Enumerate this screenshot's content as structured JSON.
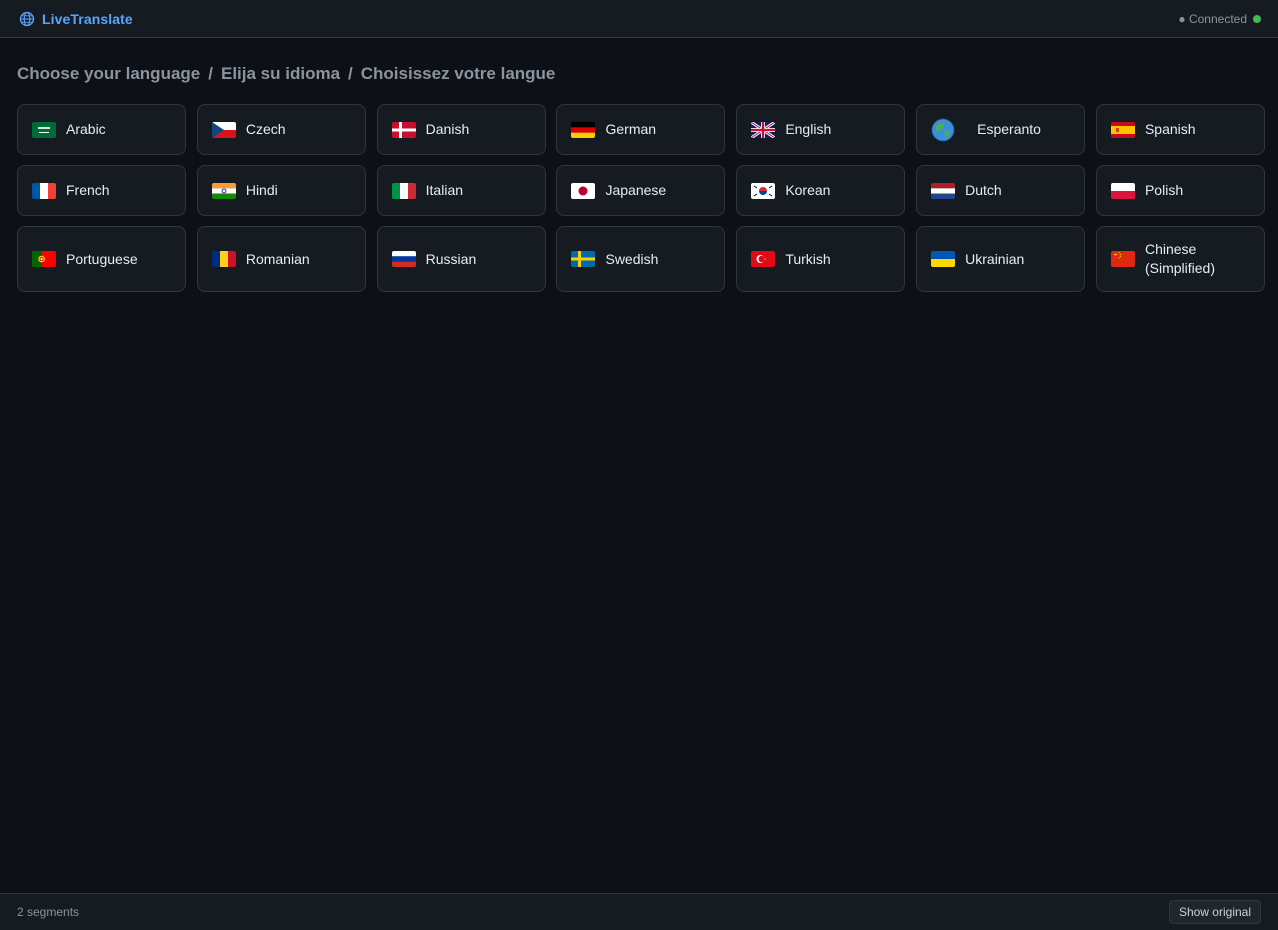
{
  "header": {
    "brand_icon": "globe-icon",
    "title": "LiveTranslate",
    "status_text": "● Connected",
    "status_color": "#3fb950"
  },
  "main": {
    "heading_parts": [
      "Choose your language",
      "/",
      "Elija su idioma",
      "/",
      "Choisissez votre langue"
    ],
    "languages": [
      {
        "label": "Arabic",
        "flag": "sa-flag-icon"
      },
      {
        "label": "Czech",
        "flag": "cz-flag-icon"
      },
      {
        "label": "Danish",
        "flag": "dk-flag-icon"
      },
      {
        "label": "German",
        "flag": "de-flag-icon"
      },
      {
        "label": "English",
        "flag": "gb-flag-icon"
      },
      {
        "label": "Esperanto",
        "flag": "globe-icon"
      },
      {
        "label": "Spanish",
        "flag": "es-flag-icon"
      },
      {
        "label": "French",
        "flag": "fr-flag-icon"
      },
      {
        "label": "Hindi",
        "flag": "in-flag-icon"
      },
      {
        "label": "Italian",
        "flag": "it-flag-icon"
      },
      {
        "label": "Japanese",
        "flag": "jp-flag-icon"
      },
      {
        "label": "Korean",
        "flag": "kr-flag-icon"
      },
      {
        "label": "Dutch",
        "flag": "nl-flag-icon"
      },
      {
        "label": "Polish",
        "flag": "pl-flag-icon"
      },
      {
        "label": "Portuguese",
        "flag": "pt-flag-icon"
      },
      {
        "label": "Romanian",
        "flag": "ro-flag-icon"
      },
      {
        "label": "Russian",
        "flag": "ru-flag-icon"
      },
      {
        "label": "Swedish",
        "flag": "se-flag-icon"
      },
      {
        "label": "Turkish",
        "flag": "tr-flag-icon"
      },
      {
        "label": "Ukrainian",
        "flag": "ua-flag-icon"
      },
      {
        "label": "Chinese (Simplified)",
        "flag": "cn-flag-icon"
      }
    ]
  },
  "footer": {
    "segments_text": "2 segments",
    "show_original_label": "Show original"
  },
  "colors": {
    "background": "#0d1117",
    "card": "#161b22",
    "border": "#30363d",
    "accent": "#58a6ff",
    "muted_text": "#8b949e"
  }
}
